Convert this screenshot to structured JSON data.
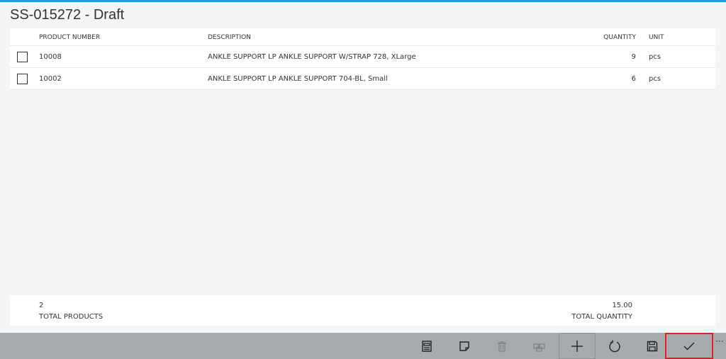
{
  "header": {
    "title": "SS-015272 - Draft"
  },
  "grid": {
    "columns": {
      "product_number": "PRODUCT NUMBER",
      "description": "DESCRIPTION",
      "quantity": "QUANTITY",
      "unit": "UNIT"
    },
    "rows": [
      {
        "product_number": "10008",
        "description": "ANKLE SUPPORT LP ANKLE SUPPORT W/STRAP 728, XLarge",
        "quantity": "9",
        "unit": "pcs"
      },
      {
        "product_number": "10002",
        "description": "ANKLE SUPPORT LP ANKLE SUPPORT 704-BL, Small",
        "quantity": "6",
        "unit": "pcs"
      }
    ]
  },
  "totals": {
    "total_products_value": "2",
    "total_products_label": "TOTAL PRODUCTS",
    "total_quantity_value": "15.00",
    "total_quantity_label": "TOTAL QUANTITY"
  },
  "appbar": {
    "buttons": [
      "document-icon",
      "note-icon",
      "delete-icon",
      "boxes-icon",
      "add-icon",
      "refresh-icon",
      "save-icon",
      "checkmark-icon"
    ],
    "more_label": "···"
  },
  "colors": {
    "accent": "#1ba1e2",
    "appbar_bg": "#a7abb0",
    "highlight": "#e0231e"
  }
}
